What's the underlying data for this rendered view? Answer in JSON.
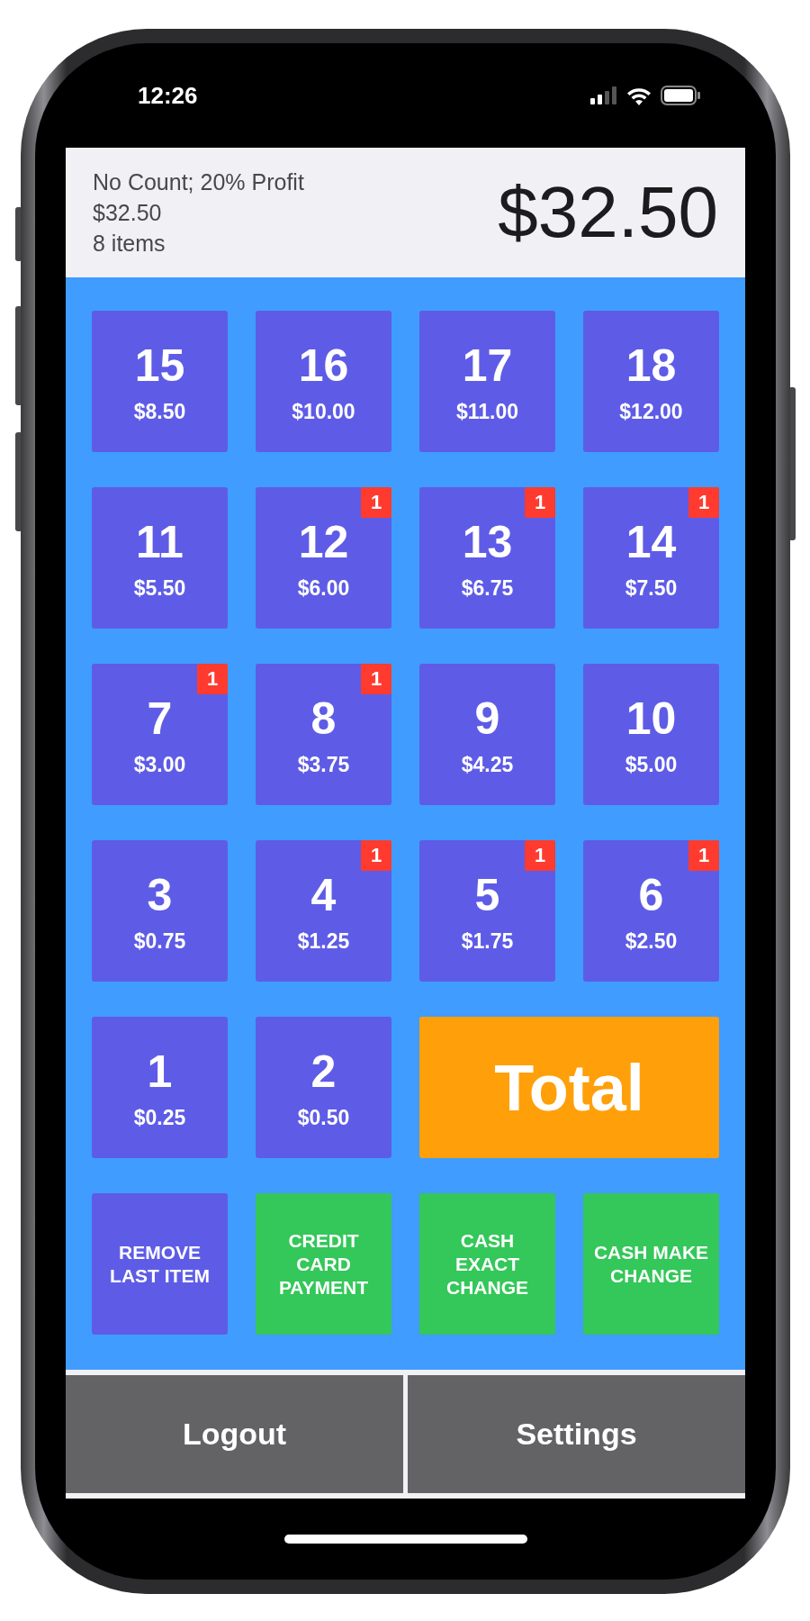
{
  "status_bar": {
    "time": "12:26"
  },
  "header": {
    "lines": [
      "No Count; 20% Profit",
      "$32.50",
      "8 items"
    ],
    "total": "$32.50"
  },
  "tiles": [
    {
      "kind": "item",
      "number": "15",
      "price": "$8.50"
    },
    {
      "kind": "item",
      "number": "16",
      "price": "$10.00"
    },
    {
      "kind": "item",
      "number": "17",
      "price": "$11.00"
    },
    {
      "kind": "item",
      "number": "18",
      "price": "$12.00"
    },
    {
      "kind": "item",
      "number": "11",
      "price": "$5.50"
    },
    {
      "kind": "item",
      "number": "12",
      "price": "$6.00",
      "badge": "1"
    },
    {
      "kind": "item",
      "number": "13",
      "price": "$6.75",
      "badge": "1"
    },
    {
      "kind": "item",
      "number": "14",
      "price": "$7.50",
      "badge": "1"
    },
    {
      "kind": "item",
      "number": "7",
      "price": "$3.00",
      "badge": "1"
    },
    {
      "kind": "item",
      "number": "8",
      "price": "$3.75",
      "badge": "1"
    },
    {
      "kind": "item",
      "number": "9",
      "price": "$4.25"
    },
    {
      "kind": "item",
      "number": "10",
      "price": "$5.00"
    },
    {
      "kind": "item",
      "number": "3",
      "price": "$0.75"
    },
    {
      "kind": "item",
      "number": "4",
      "price": "$1.25",
      "badge": "1"
    },
    {
      "kind": "item",
      "number": "5",
      "price": "$1.75",
      "badge": "1"
    },
    {
      "kind": "item",
      "number": "6",
      "price": "$2.50",
      "badge": "1"
    },
    {
      "kind": "item",
      "number": "1",
      "price": "$0.25"
    },
    {
      "kind": "item",
      "number": "2",
      "price": "$0.50"
    },
    {
      "kind": "total",
      "label": "Total"
    },
    {
      "kind": "action",
      "label": "REMOVE LAST ITEM",
      "color": "#5e5ce6"
    },
    {
      "kind": "action",
      "label": "CREDIT CARD PAYMENT",
      "color": "#34c759"
    },
    {
      "kind": "action",
      "label": "CASH EXACT CHANGE",
      "color": "#34c759"
    },
    {
      "kind": "action",
      "label": "CASH MAKE CHANGE",
      "color": "#34c759"
    }
  ],
  "bottom_buttons": [
    "Logout",
    "Settings"
  ]
}
